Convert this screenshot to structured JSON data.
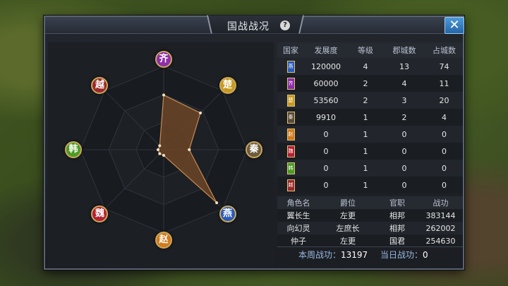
{
  "window": {
    "title": "国战战况",
    "help_glyph": "?",
    "close_glyph": "✕"
  },
  "radar": {
    "kingdoms": [
      {
        "name": "齐",
        "color": "#8e2fa8"
      },
      {
        "name": "楚",
        "color": "#c79a23"
      },
      {
        "name": "秦",
        "color": "#6b5a3e"
      },
      {
        "name": "燕",
        "color": "#2a5bb8"
      },
      {
        "name": "赵",
        "color": "#d07a1c"
      },
      {
        "name": "魏",
        "color": "#b52030"
      },
      {
        "name": "韩",
        "color": "#4d9a25"
      },
      {
        "name": "越",
        "color": "#9a2a2a"
      }
    ],
    "fill_color": "#6b4426",
    "stroke_color": "#c98b52"
  },
  "nations_table": {
    "headers": [
      "国家",
      "发展度",
      "等级",
      "郡城数",
      "占城数"
    ],
    "rows": [
      {
        "flag": "燕",
        "flag_color": "#2a5bb8",
        "dev": "120000",
        "level": "4",
        "cities": "13",
        "occupied": "74"
      },
      {
        "flag": "齐",
        "flag_color": "#8e2fa8",
        "dev": "60000",
        "level": "2",
        "cities": "4",
        "occupied": "11"
      },
      {
        "flag": "楚",
        "flag_color": "#c79a23",
        "dev": "53560",
        "level": "2",
        "cities": "3",
        "occupied": "20"
      },
      {
        "flag": "秦",
        "flag_color": "#5a4a36",
        "dev": "9910",
        "level": "1",
        "cities": "2",
        "occupied": "4"
      },
      {
        "flag": "赵",
        "flag_color": "#d07a1c",
        "dev": "0",
        "level": "1",
        "cities": "0",
        "occupied": "0"
      },
      {
        "flag": "魏",
        "flag_color": "#b52030",
        "dev": "0",
        "level": "1",
        "cities": "0",
        "occupied": "0"
      },
      {
        "flag": "韩",
        "flag_color": "#4d9a25",
        "dev": "0",
        "level": "1",
        "cities": "0",
        "occupied": "0"
      },
      {
        "flag": "越",
        "flag_color": "#9a2a2a",
        "dev": "0",
        "level": "1",
        "cities": "0",
        "occupied": "0"
      }
    ]
  },
  "roles_table": {
    "headers": [
      "角色名",
      "爵位",
      "官职",
      "战功"
    ],
    "rows": [
      {
        "name": "翼长生",
        "rank": "左更",
        "office": "相邦",
        "merit": "383144"
      },
      {
        "name": "向幻灵",
        "rank": "左庶长",
        "office": "相邦",
        "merit": "262002"
      },
      {
        "name": "仲子",
        "rank": "左更",
        "office": "国君",
        "merit": "254630"
      }
    ]
  },
  "footer": {
    "weekly_label": "本周战功：",
    "weekly_value": "13197",
    "daily_label": "当日战功：",
    "daily_value": "0"
  }
}
